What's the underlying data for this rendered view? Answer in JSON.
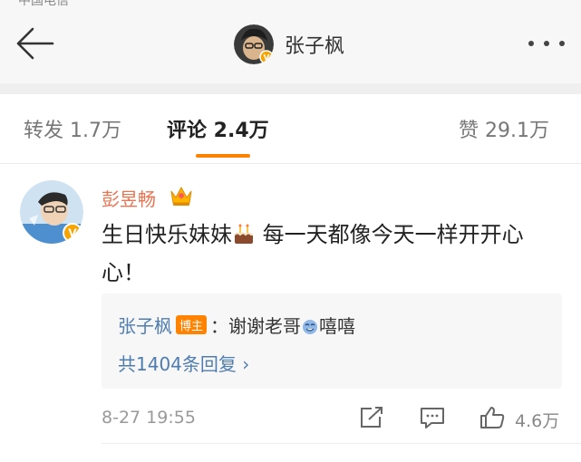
{
  "status_bar": {
    "text": "中国电信"
  },
  "header": {
    "title": "张子枫"
  },
  "tabs": [
    {
      "label": "转发 1.7万"
    },
    {
      "label": "评论 2.4万"
    },
    {
      "label": "赞 29.1万"
    }
  ],
  "comment": {
    "author": "彭昱畅",
    "text_part1": "生日快乐妹妹",
    "text_part2": " 每一天都像今天一样开开心心！",
    "reply": {
      "name": "张子枫",
      "badge": "博主",
      "text_part1": "：谢谢老哥",
      "text_part2": "嘻嘻",
      "count_label": "共1404条回复 ›"
    },
    "time": "8-27 19:55",
    "likes": "4.6万"
  },
  "colors": {
    "accent": "#ff8200",
    "name": "#eb7350",
    "link": "#507daf"
  }
}
